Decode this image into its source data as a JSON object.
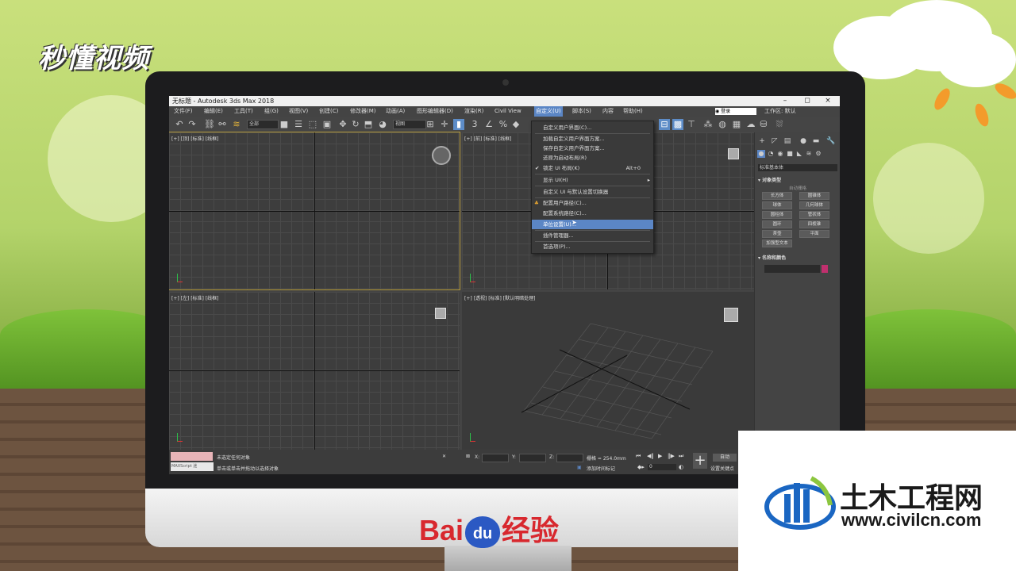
{
  "watermark_tl": "秒懂视频",
  "baidu": {
    "left": "Bai",
    "paw": "du",
    "right": "经验"
  },
  "civilcn": {
    "name": "土木工程网",
    "url": "www.civilcn.com"
  },
  "window": {
    "title": "无标题 - Autodesk 3ds Max 2018",
    "buttons": {
      "min": "–",
      "max": "◻",
      "close": "×"
    }
  },
  "menus": [
    "文件(F)",
    "编辑(E)",
    "工具(T)",
    "组(G)",
    "视图(V)",
    "创建(C)",
    "修改器(M)",
    "动画(A)",
    "图形编辑器(D)",
    "渲染(R)",
    "Civil View",
    "自定义(U)",
    "脚本(S)",
    "内容",
    "帮助(H)"
  ],
  "search": {
    "value": "登录"
  },
  "workspace": {
    "label": "工作区: 默认"
  },
  "toolbar": {
    "filter_value": "全部",
    "view_value": "视图"
  },
  "viewports": {
    "top": "[+] [顶] [标准] [线框]",
    "front": "[+] [前] [标准] [线框]",
    "left": "[+] [左] [标准] [线框]",
    "persp": "[+] [透视] [标准] [默认明暗处理]"
  },
  "dropdown": {
    "items": [
      {
        "label": "自定义用户界面(C)..."
      },
      {
        "label": "加载自定义用户界面方案..."
      },
      {
        "label": "保存自定义用户界面方案..."
      },
      {
        "label": "还原为启动布局(R)"
      },
      {
        "label": "锁定 UI 布局(K)",
        "shortcut": "Alt+0",
        "checked": "✔"
      },
      {
        "label": "显示 UI(H)",
        "arrow": "▸"
      },
      {
        "label": "自定义 UI 与默认设置切换器"
      },
      {
        "label": "配置用户路径(C)..."
      },
      {
        "label": "配置系统路径(C)..."
      },
      {
        "label": "单位设置(U)..."
      },
      {
        "label": "插件管理器..."
      },
      {
        "label": "首选项(P)..."
      }
    ]
  },
  "command_panel": {
    "category": "标准基本体",
    "object_type_title": "对象类型",
    "autogrid": "自动栅格",
    "buttons": [
      "长方体",
      "圆锥体",
      "球体",
      "几何球体",
      "圆柱体",
      "管状体",
      "圆环",
      "四棱锥",
      "茶壶",
      "平面",
      "加强型文本"
    ],
    "name_color_title": "名称和颜色",
    "colors": {
      "swatch": "#c0306e"
    }
  },
  "status": {
    "maxscript": "MAXScript 迷",
    "line1": "未选定任何对象",
    "line2": "单击或单击并拖动以选择对象",
    "x_label": "X:",
    "y_label": "Y:",
    "z_label": "Z:",
    "grid": "栅格 = 254.0mm",
    "add_time_tag": "添加时间标记",
    "frame": "0",
    "auto": "自动",
    "set_key": "设置关键点"
  }
}
